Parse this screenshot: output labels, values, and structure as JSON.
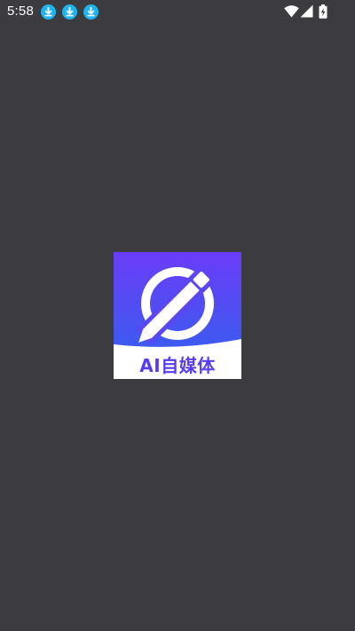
{
  "status_bar": {
    "time": "5:58",
    "notifications": [
      "download-icon",
      "download-icon",
      "download-icon"
    ],
    "notification_color": "#1fb4f0",
    "right_icons": [
      "wifi-icon",
      "cellular-signal-icon",
      "battery-charging-icon"
    ]
  },
  "splash": {
    "logo_text": "AI自媒体",
    "logo_gradient": [
      "#6a3cf7",
      "#3e5af0"
    ],
    "logo_text_color": "#5a3cf0",
    "background": "#3b3b40"
  }
}
